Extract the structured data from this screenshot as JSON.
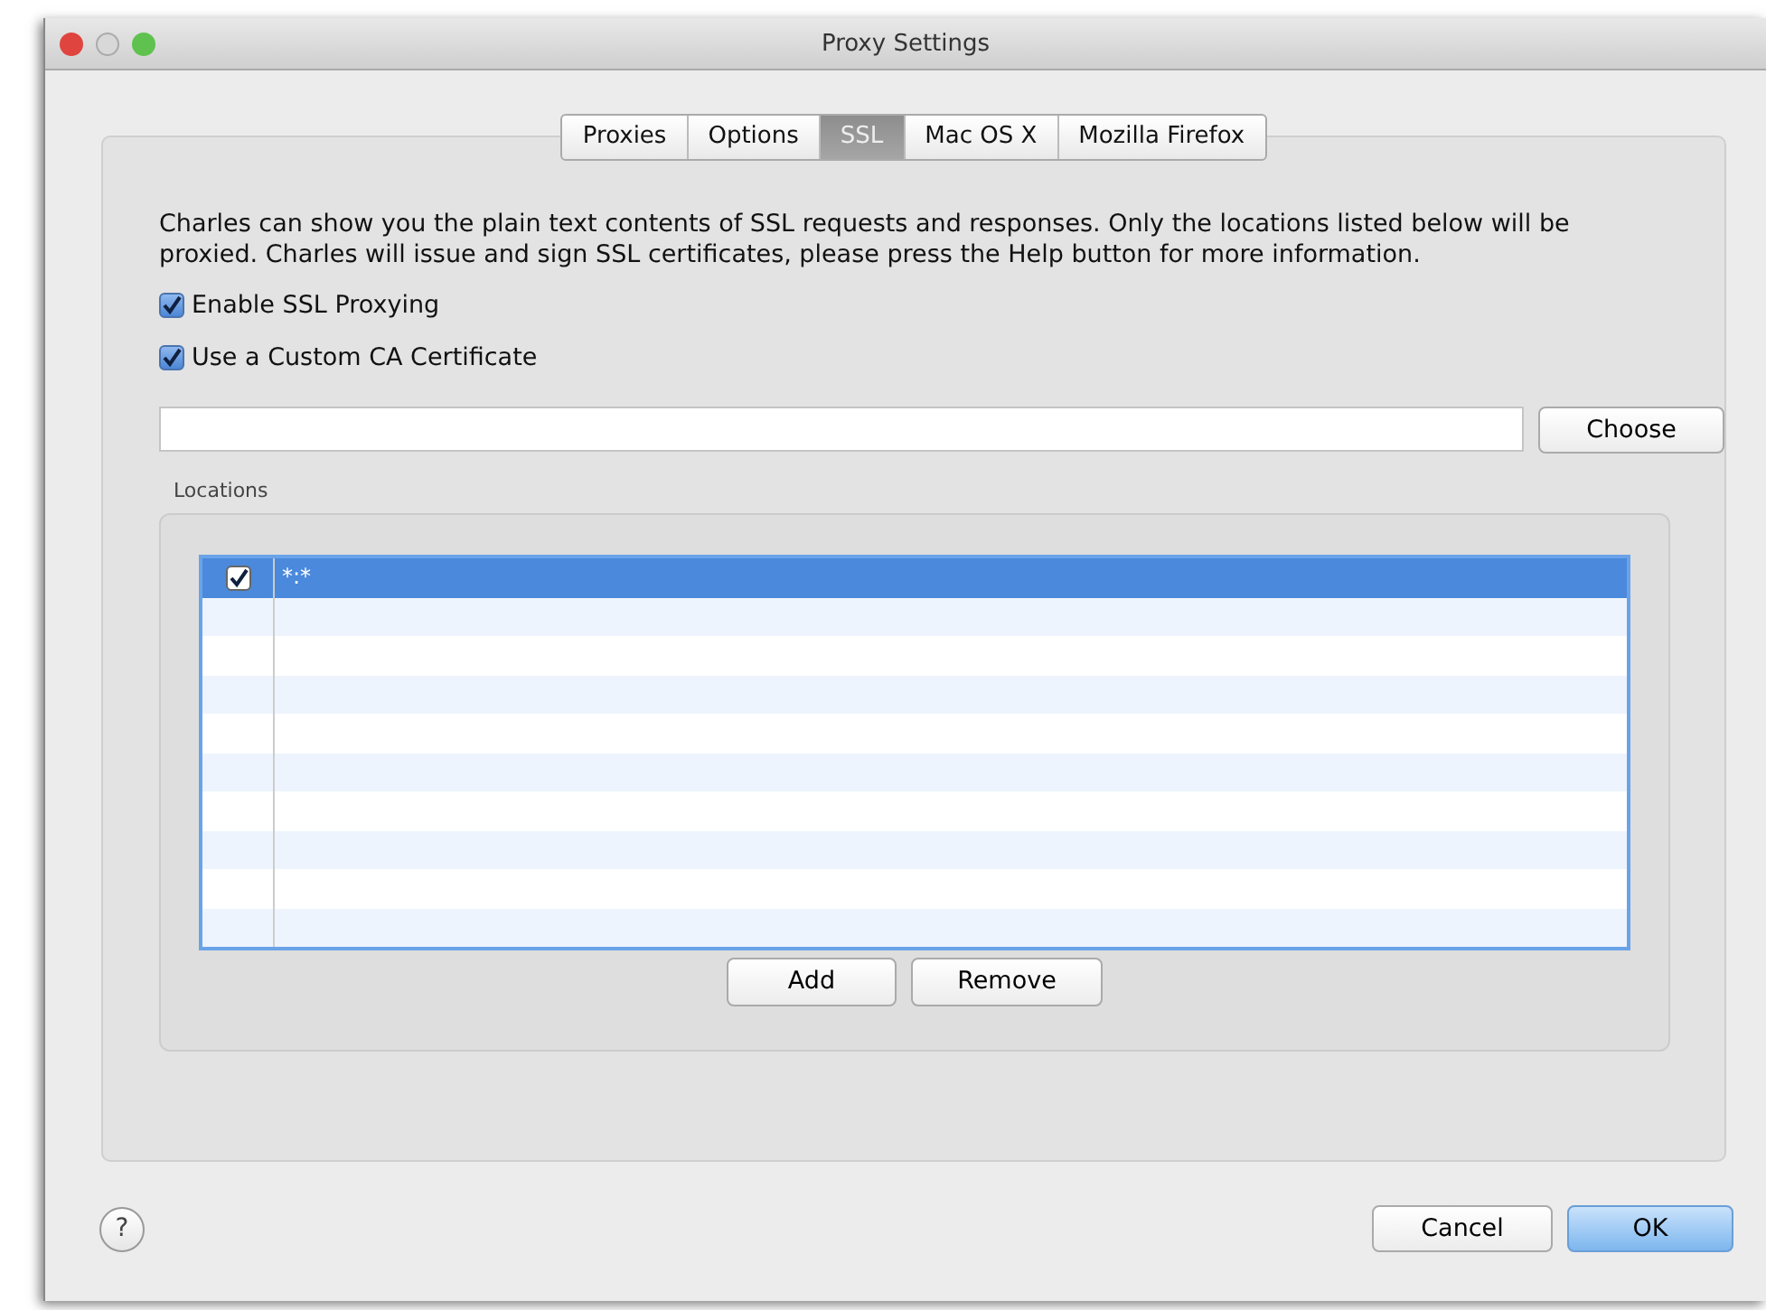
{
  "window": {
    "title": "Proxy Settings"
  },
  "tabs": [
    {
      "label": "Proxies",
      "selected": false
    },
    {
      "label": "Options",
      "selected": false
    },
    {
      "label": "SSL",
      "selected": true
    },
    {
      "label": "Mac OS X",
      "selected": false
    },
    {
      "label": "Mozilla Firefox",
      "selected": false
    }
  ],
  "description": "Charles can show you the plain text contents of SSL requests and responses. Only the locations listed below will be proxied. Charles will issue and sign SSL certificates, please press the Help button for more information.",
  "options": [
    {
      "label": "Enable SSL Proxying",
      "checked": true
    },
    {
      "label": "Use a Custom CA Certificate",
      "checked": true
    }
  ],
  "certificate": {
    "choose_button": "Choose"
  },
  "locations": {
    "label": "Locations",
    "rows": [
      {
        "enabled": true,
        "host": "*:*",
        "selected": true
      }
    ],
    "buttons": [
      "Add",
      "Remove"
    ]
  },
  "footer": {
    "help": "?",
    "buttons": [
      {
        "label": "Cancel",
        "kind": "normal"
      },
      {
        "label": "OK",
        "kind": "default"
      }
    ]
  }
}
